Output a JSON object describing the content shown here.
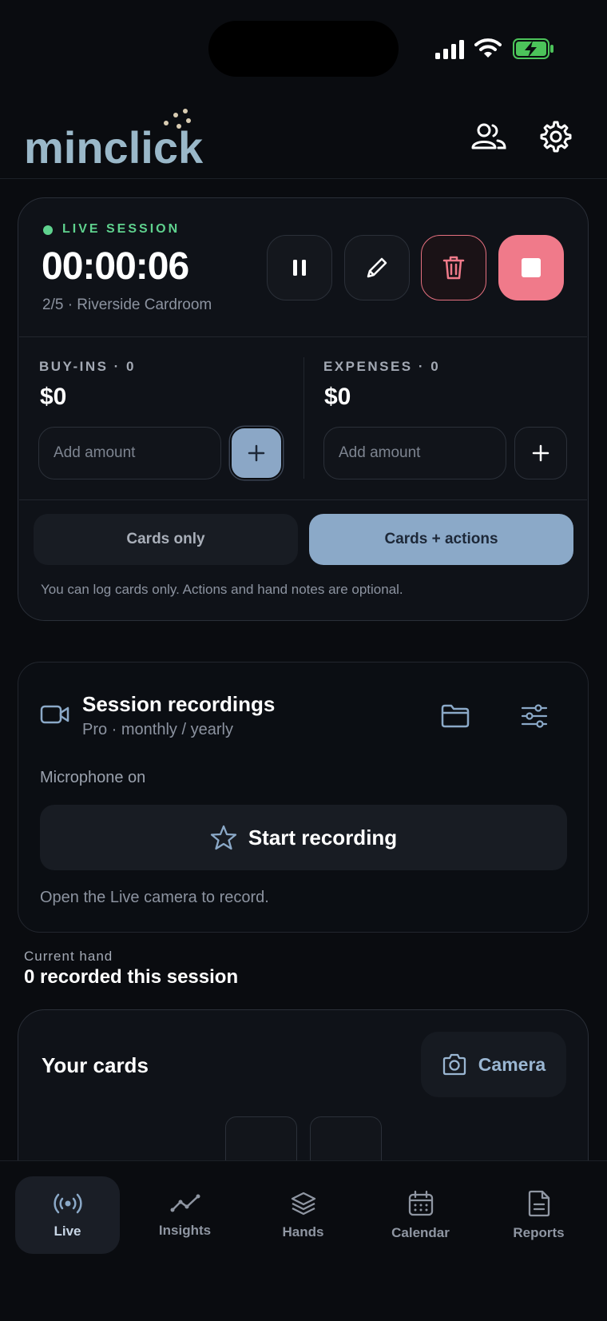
{
  "app": {
    "logo_text": "minclick"
  },
  "header": {
    "people_icon": "people-icon",
    "settings_icon": "gear-icon"
  },
  "session": {
    "status_label": "LIVE SESSION",
    "timer": "00:00:06",
    "details": "2/5 · Riverside Cardroom",
    "status_color": "#5fd28e",
    "controls": [
      "pause-icon",
      "pencil-icon",
      "trash-icon",
      "stop-icon"
    ]
  },
  "buyins": {
    "label": "BUY-INS · 0",
    "amount": "$0",
    "placeholder": "Add amount"
  },
  "expenses": {
    "label": "EXPENSES · 0",
    "amount": "$0",
    "placeholder": "Add amount"
  },
  "mode": {
    "cards_only": "Cards only",
    "cards_actions": "Cards + actions",
    "selected": "Cards + actions",
    "hint": "You can log cards only. Actions and hand notes are optional."
  },
  "recordings": {
    "title": "Session recordings",
    "subtitle": "Pro · monthly / yearly",
    "mic_status": "Microphone on",
    "start_label": "Start recording",
    "hint": "Open the Live camera to record."
  },
  "current_hand": {
    "label": "Current hand",
    "value": "0 recorded this session"
  },
  "your_cards": {
    "title": "Your cards",
    "camera_label": "Camera"
  },
  "nav": {
    "items": [
      {
        "label": "Live",
        "icon": "broadcast-icon",
        "active": true
      },
      {
        "label": "Insights",
        "icon": "trend-line-icon",
        "active": false
      },
      {
        "label": "Hands",
        "icon": "layers-icon",
        "active": false
      },
      {
        "label": "Calendar",
        "icon": "calendar-icon",
        "active": false
      },
      {
        "label": "Reports",
        "icon": "document-icon",
        "active": false
      }
    ]
  },
  "colors": {
    "accent": "#8ba9c8",
    "danger": "#f07a8a",
    "live": "#5fd28e",
    "background": "#0a0c10"
  }
}
